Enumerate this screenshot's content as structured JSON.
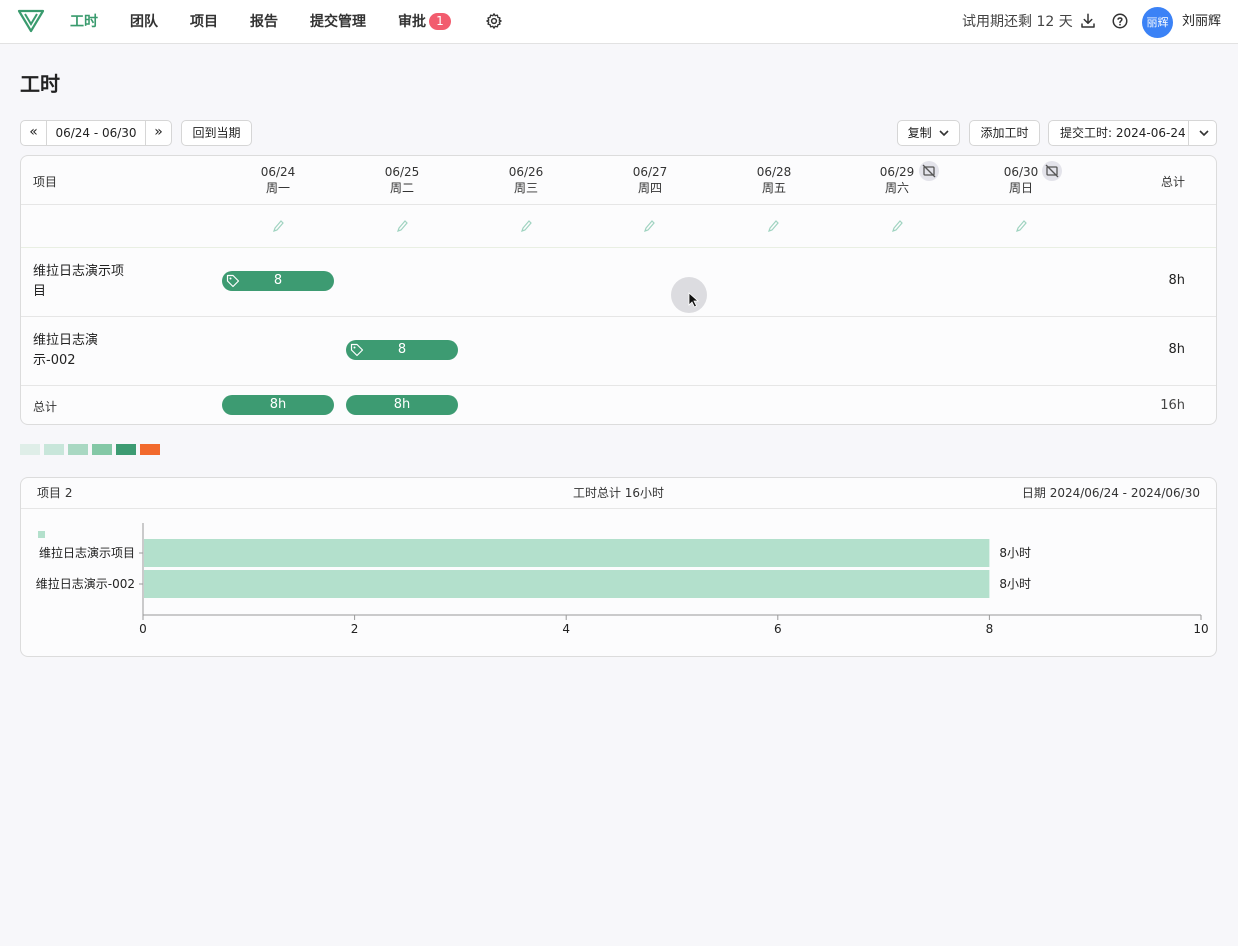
{
  "nav": {
    "items": [
      {
        "label": "工时",
        "active": true
      },
      {
        "label": "团队"
      },
      {
        "label": "项目"
      },
      {
        "label": "报告"
      },
      {
        "label": "提交管理"
      },
      {
        "label": "审批",
        "badge": "1"
      }
    ],
    "trial": "试用期还剩 12 天",
    "avatar_text": "丽辉",
    "user_name": "刘丽辉"
  },
  "page": {
    "title": "工时",
    "week_range": "06/24 - 06/30",
    "back_to_current": "回到当期",
    "copy": "复制",
    "add_time": "添加工时",
    "submit": "提交工时: 2024-06-24"
  },
  "grid": {
    "project_header": "项目",
    "total_header": "总计",
    "days": [
      {
        "date": "06/24",
        "weekday": "周一",
        "hidden_icon": false
      },
      {
        "date": "06/25",
        "weekday": "周二",
        "hidden_icon": false
      },
      {
        "date": "06/26",
        "weekday": "周三",
        "hidden_icon": false
      },
      {
        "date": "06/27",
        "weekday": "周四",
        "hidden_icon": false
      },
      {
        "date": "06/28",
        "weekday": "周五",
        "hidden_icon": false
      },
      {
        "date": "06/29",
        "weekday": "周六",
        "hidden_icon": true
      },
      {
        "date": "06/30",
        "weekday": "周日",
        "hidden_icon": true
      }
    ],
    "rows": [
      {
        "name_line1": "维拉日志演示项",
        "name_line2": "目",
        "entries": [
          {
            "day": 0,
            "value": "8"
          }
        ],
        "total": "8h"
      },
      {
        "name_line1": "维拉日志演",
        "name_line2": "示-002",
        "entries": [
          {
            "day": 1,
            "value": "8"
          }
        ],
        "total": "8h"
      }
    ],
    "totals_label": "总计",
    "day_totals": [
      {
        "day": 0,
        "value": "8h"
      },
      {
        "day": 1,
        "value": "8h"
      }
    ],
    "grand_total": "16h"
  },
  "legend_colors": [
    "#dfeee8",
    "#c8e6da",
    "#a9d8c2",
    "#84c8a6",
    "#3d9b72",
    "#f26a2d"
  ],
  "summary": {
    "projects": "项目 2",
    "total": "工时总计 16小时",
    "date_range": "日期 2024/06/24 - 2024/06/30"
  },
  "chart_data": {
    "type": "bar",
    "orientation": "horizontal",
    "categories": [
      "维拉日志演示项目",
      "维拉日志演示-002"
    ],
    "values": [
      8,
      8
    ],
    "value_labels": [
      "8小时",
      "8小时"
    ],
    "xlim": [
      0,
      10
    ],
    "xticks": [
      0,
      2,
      4,
      6,
      8,
      10
    ],
    "bar_color": "#b3e0cc",
    "grid": false
  }
}
